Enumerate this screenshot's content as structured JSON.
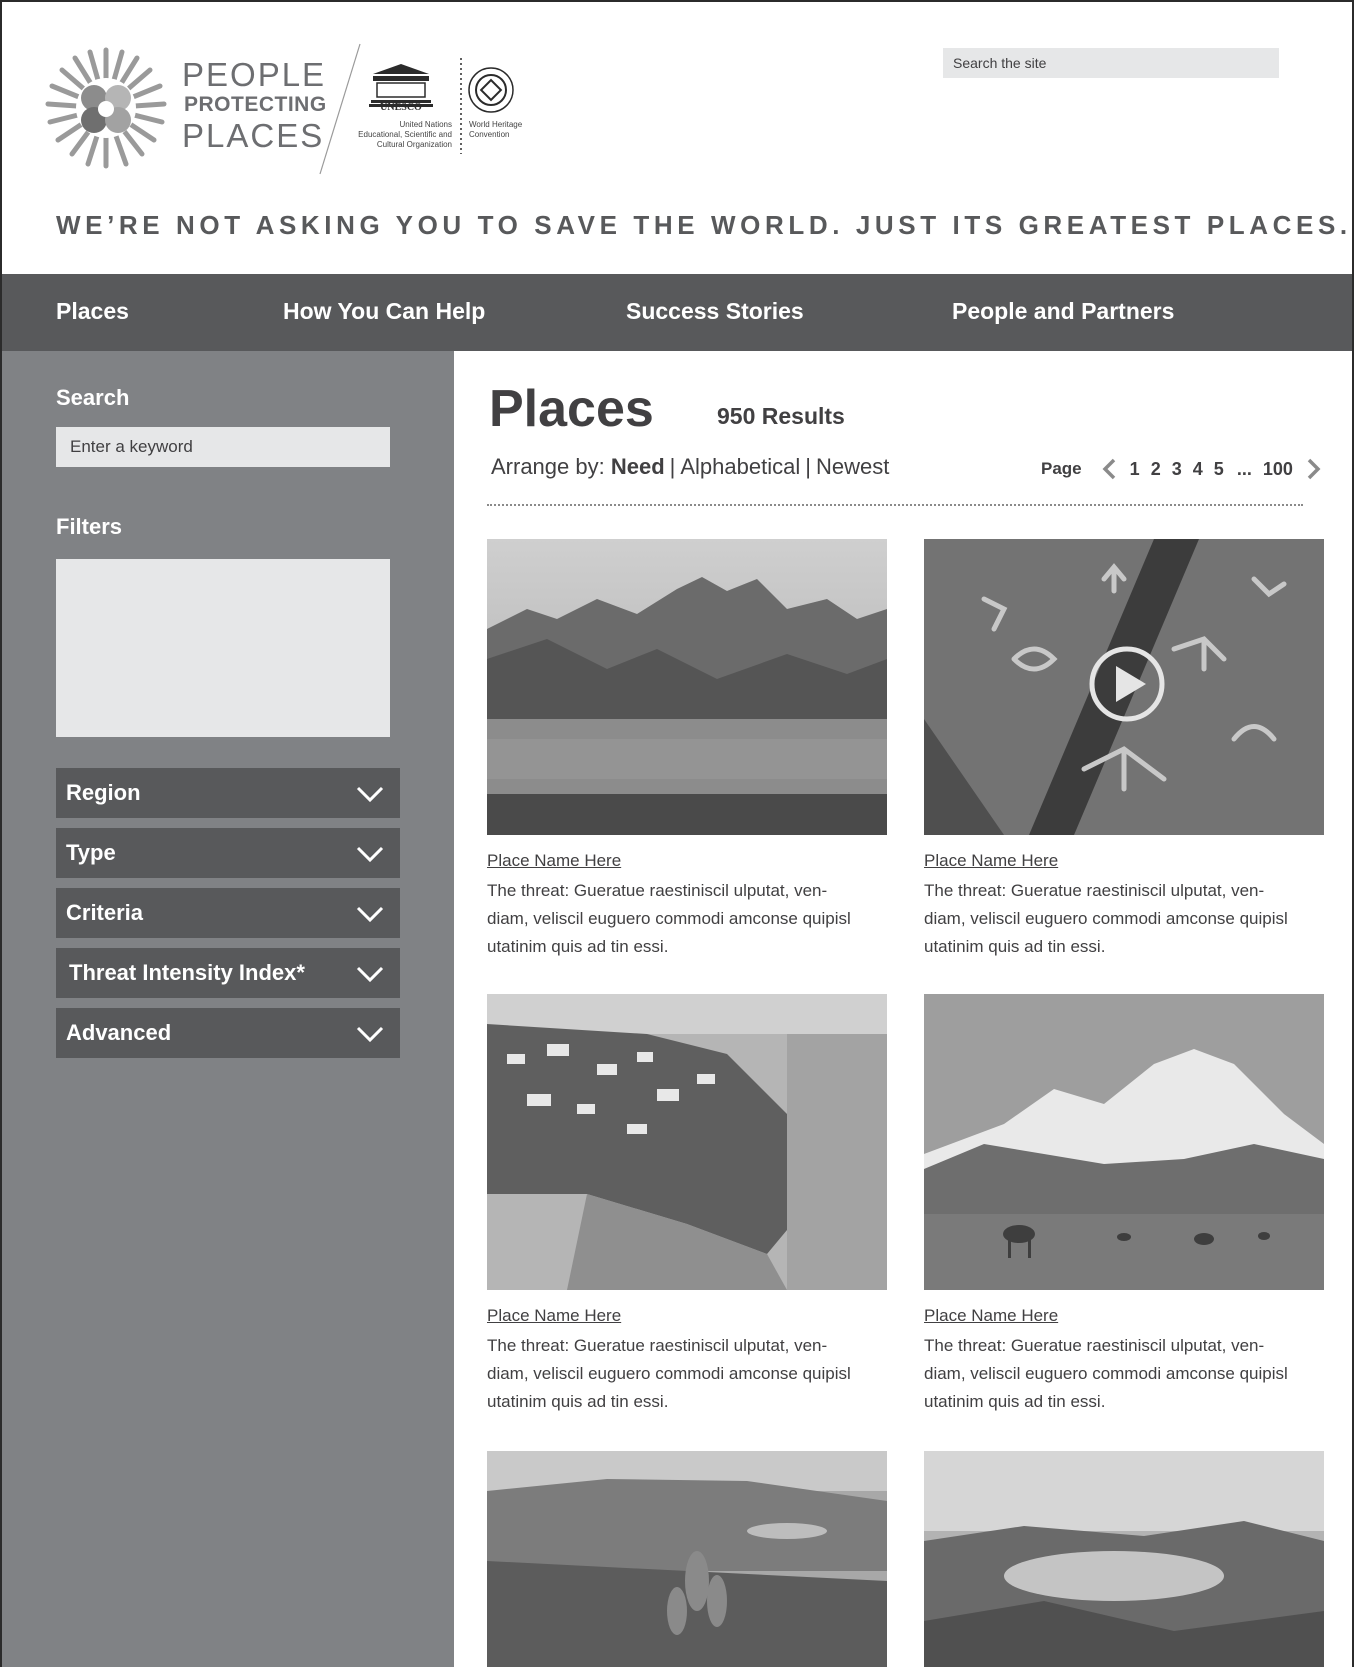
{
  "header": {
    "logo": {
      "line1": "PEOPLE",
      "line2": "PROTECTING",
      "line3": "PLACES"
    },
    "unesco": {
      "wordmark": "UNESCO",
      "org_name": "United Nations Educational, Scientific and Cultural Organization",
      "convention": "World Heritage Convention"
    },
    "search_placeholder": "Search the site",
    "tagline": "WE’RE NOT ASKING YOU TO SAVE THE WORLD. JUST ITS GREATEST PLACES."
  },
  "nav": {
    "items": [
      "Places",
      "How You Can Help",
      "Success Stories",
      "People and Partners"
    ]
  },
  "sidebar": {
    "search_heading": "Search",
    "keyword_placeholder": "Enter a keyword",
    "filters_heading": "Filters",
    "dropdowns": [
      "Region",
      "Type",
      "Criteria",
      "Threat Intensity Index*",
      "Advanced"
    ]
  },
  "main": {
    "title": "Places",
    "results": "950 Results",
    "arrange": {
      "label": "Arrange by:",
      "options": [
        "Need",
        "Alphabetical",
        "Newest"
      ],
      "active": "Need"
    },
    "pager": {
      "label": "Page",
      "pages": [
        "1",
        "2",
        "3",
        "4",
        "5"
      ],
      "ellipsis": "...",
      "last": "100"
    },
    "cards": [
      {
        "name": "Place Name Here",
        "desc": [
          "The threat: Gueratue raestiniscil ulputat, ven-",
          "diam, veliscil euguero commodi amconse quipisl",
          "utatinim quis ad tin essi."
        ],
        "image": "mountain-lake-photo"
      },
      {
        "name": "Place Name Here",
        "desc": [
          "The threat: Gueratue raestiniscil ulputat, ven-",
          "diam, veliscil euguero commodi amconse quipisl",
          "utatinim quis ad tin essi."
        ],
        "image": "rock-art-video"
      },
      {
        "name": "Place Name Here",
        "desc": [
          "The threat: Gueratue raestiniscil ulputat, ven-",
          "diam, veliscil euguero commodi amconse quipisl",
          "utatinim quis ad tin essi."
        ],
        "image": "coastal-town-photo"
      },
      {
        "name": "Place Name Here",
        "desc": [
          "The threat: Gueratue raestiniscil ulputat, ven-",
          "diam, veliscil euguero commodi amconse quipisl",
          "utatinim quis ad tin essi."
        ],
        "image": "snow-mountain-camels-photo"
      },
      {
        "image": "highland-plants-photo"
      },
      {
        "image": "misty-lake-valley-photo"
      }
    ]
  },
  "colors": {
    "nav_bg": "#58595b",
    "sidebar_bg": "#808285",
    "input_bg": "#e6e7e8",
    "text": "#414042"
  }
}
